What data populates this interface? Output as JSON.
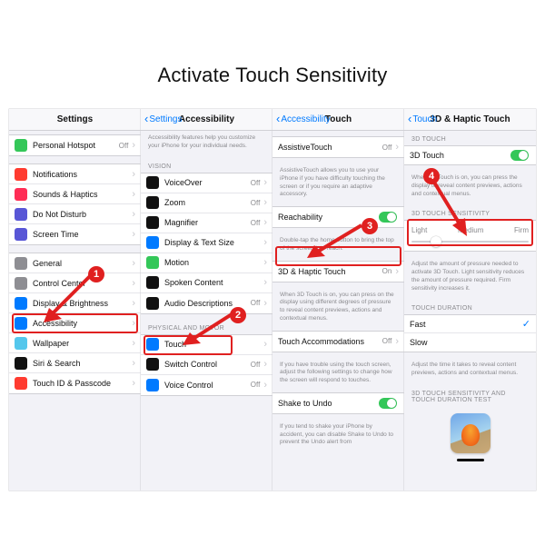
{
  "title": "Activate Touch Sensitivity",
  "steps": {
    "s1": "1",
    "s2": "2",
    "s3": "3",
    "s4": "4"
  },
  "p1": {
    "header": "Settings",
    "rows": [
      {
        "label": "Personal Hotspot",
        "right": "Off",
        "icon": "#34c759"
      },
      {
        "label": "Notifications",
        "icon": "#ff3b30"
      },
      {
        "label": "Sounds & Haptics",
        "icon": "#ff2d55"
      },
      {
        "label": "Do Not Disturb",
        "icon": "#5856d6"
      },
      {
        "label": "Screen Time",
        "icon": "#5856d6"
      },
      {
        "label": "General",
        "icon": "#8e8e93"
      },
      {
        "label": "Control Center",
        "icon": "#8e8e93"
      },
      {
        "label": "Display & Brightness",
        "icon": "#007aff"
      },
      {
        "label": "Accessibility",
        "icon": "#007aff"
      },
      {
        "label": "Wallpaper",
        "icon": "#54c7ec"
      },
      {
        "label": "Siri & Search",
        "icon": "#111"
      },
      {
        "label": "Touch ID & Passcode",
        "icon": "#ff3b30"
      }
    ]
  },
  "p2": {
    "back": "Settings",
    "header": "Accessibility",
    "intro": "Accessibility features help you customize your iPhone for your individual needs.",
    "visionLabel": "VISION",
    "vision": [
      {
        "label": "VoiceOver",
        "right": "Off",
        "icon": "#111"
      },
      {
        "label": "Zoom",
        "right": "Off",
        "icon": "#111"
      },
      {
        "label": "Magnifier",
        "right": "Off",
        "icon": "#111"
      },
      {
        "label": "Display & Text Size",
        "icon": "#007aff"
      },
      {
        "label": "Motion",
        "icon": "#34c759"
      },
      {
        "label": "Spoken Content",
        "icon": "#111"
      },
      {
        "label": "Audio Descriptions",
        "right": "Off",
        "icon": "#111"
      }
    ],
    "motorLabel": "PHYSICAL AND MOTOR",
    "motor": [
      {
        "label": "Touch",
        "icon": "#007aff"
      },
      {
        "label": "Switch Control",
        "right": "Off",
        "icon": "#111"
      },
      {
        "label": "Voice Control",
        "right": "Off",
        "icon": "#007aff"
      }
    ]
  },
  "p3": {
    "back": "Accessibility",
    "header": "Touch",
    "assistive": {
      "label": "AssistiveTouch",
      "right": "Off"
    },
    "assistiveDesc": "AssistiveTouch allows you to use your iPhone if you have difficulty touching the screen or if you require an adaptive accessory.",
    "reach": {
      "label": "Reachability"
    },
    "reachDesc": "Double-tap the home button to bring the top of the screen into reach.",
    "haptic": {
      "label": "3D & Haptic Touch",
      "right": "On"
    },
    "hapticDesc": "When 3D Touch is on, you can press on the display using different degrees of pressure to reveal content previews, actions and contextual menus.",
    "accom": {
      "label": "Touch Accommodations",
      "right": "Off"
    },
    "accomDesc": "If you have trouble using the touch screen, adjust the following settings to change how the screen will respond to touches.",
    "shake": {
      "label": "Shake to Undo"
    },
    "shakeDesc": "If you tend to shake your iPhone by accident, you can disable Shake to Undo to prevent the Undo alert from"
  },
  "p4": {
    "back": "Touch",
    "header": "3D & Haptic Touch",
    "tdLabel": "3D TOUCH",
    "td": {
      "label": "3D Touch"
    },
    "tdDesc": "When 3D Touch is on, you can press the display to reveal content previews, actions and contextual menus.",
    "sensLabel": "3D TOUCH SENSITIVITY",
    "sens": {
      "light": "Light",
      "medium": "Medium",
      "firm": "Firm"
    },
    "sensDesc": "Adjust the amount of pressure needed to activate 3D Touch. Light sensitivity reduces the amount of pressure required. Firm sensitivity increases it.",
    "durLabel": "TOUCH DURATION",
    "dur": {
      "fast": "Fast",
      "slow": "Slow"
    },
    "durDesc": "Adjust the time it takes to reveal content previews, actions and contextual menus.",
    "testLabel": "3D TOUCH SENSITIVITY AND TOUCH DURATION TEST"
  }
}
